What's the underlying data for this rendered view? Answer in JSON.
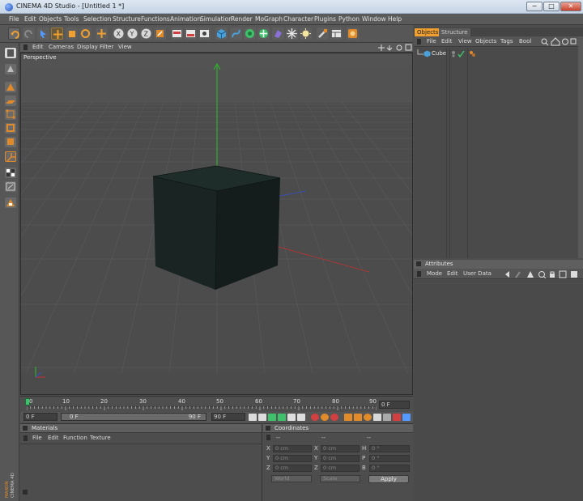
{
  "window": {
    "title": "CINEMA 4D Studio - [Untitled 1 *]",
    "minimize": "─",
    "maximize": "□",
    "close": "✕"
  },
  "menubar": [
    "File",
    "Edit",
    "Objects",
    "Tools",
    "Selection",
    "Structure",
    "Functions",
    "Animation",
    "Simulation",
    "Render",
    "MoGraph",
    "Character",
    "Plugins",
    "Python",
    "Window",
    "Help"
  ],
  "viewport": {
    "menu": [
      "Edit",
      "Cameras",
      "Display",
      "Filter",
      "View"
    ],
    "label": "Perspective"
  },
  "timeline": {
    "tick_labels": [
      "0",
      "10",
      "20",
      "30",
      "40",
      "50",
      "60",
      "70",
      "80",
      "90"
    ],
    "current_frame": "0 F",
    "start_frame": "0 F",
    "range_start": "0 F",
    "range_end": "90 F",
    "end_frame": "90 F"
  },
  "materials": {
    "title": "Materials",
    "menu": [
      "File",
      "Edit",
      "Function",
      "Texture"
    ]
  },
  "coordinates": {
    "title": "Coordinates",
    "headers": [
      "--",
      "--",
      "--"
    ],
    "rows": [
      {
        "a": "X",
        "av": "0 cm",
        "b": "X",
        "bv": "0 cm",
        "c": "H",
        "cv": "0 °"
      },
      {
        "a": "Y",
        "av": "0 cm",
        "b": "Y",
        "bv": "0 cm",
        "c": "P",
        "cv": "0 °"
      },
      {
        "a": "Z",
        "av": "0 cm",
        "b": "Z",
        "bv": "0 cm",
        "c": "B",
        "cv": "0 °"
      }
    ],
    "mode_select": "World",
    "size_select": "Scale",
    "apply": "Apply"
  },
  "objects_panel": {
    "tabs": [
      "Objects",
      "Structure"
    ],
    "menu": [
      "File",
      "Edit",
      "View",
      "Objects",
      "Tags",
      "Bool"
    ],
    "items": [
      {
        "name": "Cube"
      }
    ]
  },
  "attributes_panel": {
    "title": "Attributes",
    "menu": [
      "Mode",
      "Edit",
      "User Data"
    ]
  },
  "branding": {
    "line1": "MAXON",
    "line2": "CINEMA 4D"
  },
  "colors": {
    "accent_orange": "#e08a2a",
    "tab_active": "#f0a030",
    "axis_y": "#27c227",
    "axis_x": "#c23030",
    "axis_z": "#3050d0"
  }
}
